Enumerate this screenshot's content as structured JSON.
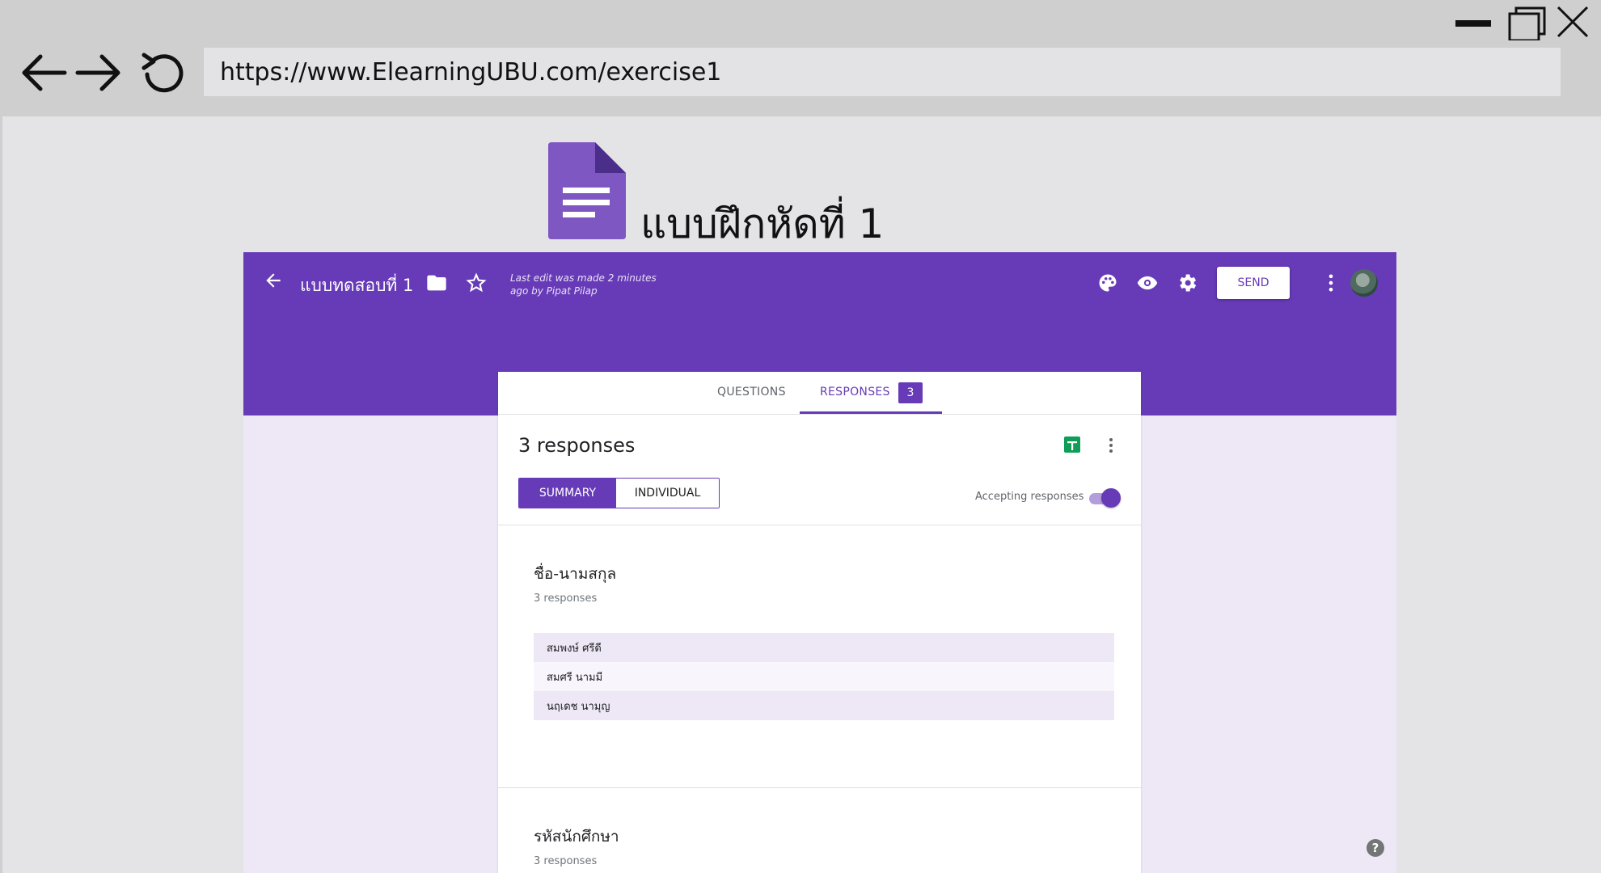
{
  "browser": {
    "url": "https://www.ElearningUBU.com/exercise1",
    "icons": [
      "back-arrow-icon",
      "forward-arrow-icon",
      "reload-icon",
      "minimize-icon",
      "maximize-icon",
      "close-icon"
    ]
  },
  "brand": {
    "title": "แบบฝึกหัดที่ 1",
    "icon": "google-forms-icon",
    "color": "#7e57c2"
  },
  "header": {
    "form_title": "แบบทดสอบที่ 1",
    "last_edit": "Last edit was made 2 minutes ago by Pipat Pilap",
    "send_label": "SEND",
    "color": "#673ab7",
    "icons": [
      "palette-icon",
      "preview-eye-icon",
      "settings-gear-icon",
      "more-vert-icon",
      "folder-icon",
      "star-icon"
    ]
  },
  "tabs": {
    "questions": "QUESTIONS",
    "responses": "RESPONSES",
    "responses_count": "3"
  },
  "summary": {
    "count_label": "3 responses",
    "segments": {
      "summary": "SUMMARY",
      "individual": "INDIVIDUAL"
    },
    "accepting_label": "Accepting responses",
    "accepting": true
  },
  "questions": [
    {
      "title": "ชื่อ-นามสกุล",
      "sub": "3 responses",
      "answers": [
        "สมพงษ์ ศรีดี",
        "สมศรี นามมี",
        "นฤเดช นามุญ"
      ]
    },
    {
      "title": "รหัสนักศึกษา",
      "sub": "3 responses"
    }
  ],
  "help": "?"
}
